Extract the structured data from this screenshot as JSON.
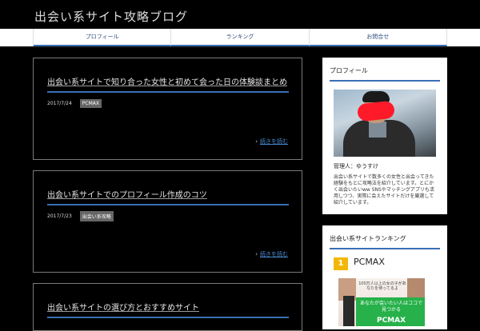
{
  "site": {
    "title": "出会い系サイト攻略ブログ"
  },
  "nav": {
    "items": [
      {
        "label": "プロフィール"
      },
      {
        "label": "ランキング"
      },
      {
        "label": "お問合せ"
      }
    ]
  },
  "posts": [
    {
      "title": "出会い系サイトで知り合った女性と初めて会った日の体験談まとめ",
      "date": "2017/7/24",
      "category": "PCMAX",
      "read_more": "続きを読む"
    },
    {
      "title": "出会い系サイトでのプロフィール作成のコツ",
      "date": "2017/7/23",
      "category": "出会い系攻略",
      "read_more": "続きを読む"
    },
    {
      "title": "出会い系サイトの選び方とおすすめサイト",
      "date": "",
      "category": "",
      "read_more": ""
    }
  ],
  "sidebar": {
    "profile": {
      "title": "プロフィール",
      "name": "管理人：ゆうすけ",
      "text": "出会い系サイトで数多くの女性と出会ってきた経験をもとに攻略法を紹介しています。とにかく出会いたいww SNSやマッチングアプリも活用しつつ、実際に会えたサイトだけを厳選して紹介しています。"
    },
    "ranking": {
      "title": "出会い系サイトランキング",
      "rank": "1",
      "name": "PCMAX",
      "banner_line1": "100万人以上の女の子があなたを待ってるよ",
      "banner_line2": "あなたが会いたい人はココで見つかる",
      "banner_logo": "PCMAX"
    }
  },
  "colors": {
    "accent": "#3a6fb5",
    "badge": "#f2b705",
    "banner_green": "#27b14a"
  }
}
